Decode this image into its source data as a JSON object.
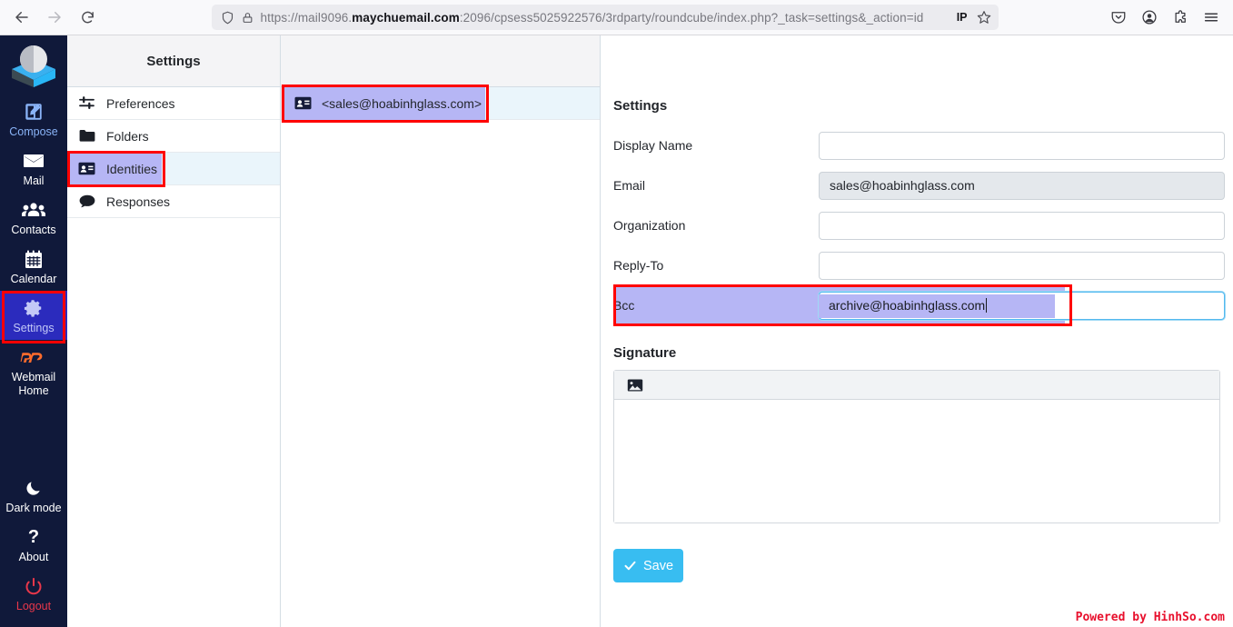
{
  "browser": {
    "back_icon": "back-arrow-icon",
    "forward_icon": "forward-arrow-icon",
    "reload_icon": "reload-icon",
    "shield_icon": "shield-icon",
    "lock_icon": "padlock-icon",
    "url_prefix": "https://mail9096.",
    "url_host": "maychuemail.com",
    "url_suffix": ":2096/cpsess5025922576/3rdparty/roundcube/index.php?_task=settings&_action=id",
    "ip_badge": "IP",
    "star_icon": "bookmark-star-icon",
    "pocket_icon": "pocket-icon",
    "account_icon": "account-icon",
    "extensions_icon": "extensions-icon",
    "menu_icon": "hamburger-menu-icon"
  },
  "taskbar": {
    "logo_name": "roundcube-logo",
    "items": [
      {
        "label": "Compose",
        "icon": "compose-pencil-icon",
        "style": "accent"
      },
      {
        "label": "Mail",
        "icon": "envelope-icon",
        "style": "normal"
      },
      {
        "label": "Contacts",
        "icon": "contacts-people-icon",
        "style": "normal"
      },
      {
        "label": "Calendar",
        "icon": "calendar-icon",
        "style": "normal"
      },
      {
        "label": "Settings",
        "icon": "gear-icon",
        "style": "selected"
      },
      {
        "label": "Webmail Home",
        "icon": "cpanel-icon",
        "style": "normal"
      }
    ],
    "bottom_items": [
      {
        "label": "Dark mode",
        "icon": "moon-icon",
        "style": "normal"
      },
      {
        "label": "About",
        "icon": "question-mark-icon",
        "style": "normal"
      },
      {
        "label": "Logout",
        "icon": "power-icon",
        "style": "danger"
      }
    ]
  },
  "settings_column": {
    "header": "Settings",
    "items": [
      {
        "label": "Preferences",
        "icon": "sliders-icon",
        "active": false
      },
      {
        "label": "Folders",
        "icon": "folder-icon",
        "active": false
      },
      {
        "label": "Identities",
        "icon": "identity-card-icon",
        "active": true
      },
      {
        "label": "Responses",
        "icon": "speech-bubble-icon",
        "active": false
      }
    ]
  },
  "identities_column": {
    "header": "",
    "rows": [
      {
        "label": "<sales@hoabinhglass.com>",
        "icon": "identity-card-icon",
        "selected": true
      }
    ]
  },
  "form": {
    "section_title": "Settings",
    "fields": [
      {
        "label": "Display Name",
        "value": "",
        "readonly": false,
        "focused": false
      },
      {
        "label": "Email",
        "value": "sales@hoabinhglass.com",
        "readonly": true,
        "focused": false
      },
      {
        "label": "Organization",
        "value": "",
        "readonly": false,
        "focused": false
      },
      {
        "label": "Reply-To",
        "value": "",
        "readonly": false,
        "focused": false
      }
    ],
    "bcc": {
      "label": "Bcc",
      "value": "archive@hoabinhglass.com",
      "focused": true,
      "selected": true
    },
    "signature_title": "Signature",
    "signature_toolbar_icon": "insert-image-icon",
    "signature_value": "",
    "save_label": "Save",
    "save_icon": "checkmark-icon",
    "save_color": "#38bdf1"
  },
  "watermark": "Powered by HinhSo.com",
  "annotation_color": "#ff0000"
}
